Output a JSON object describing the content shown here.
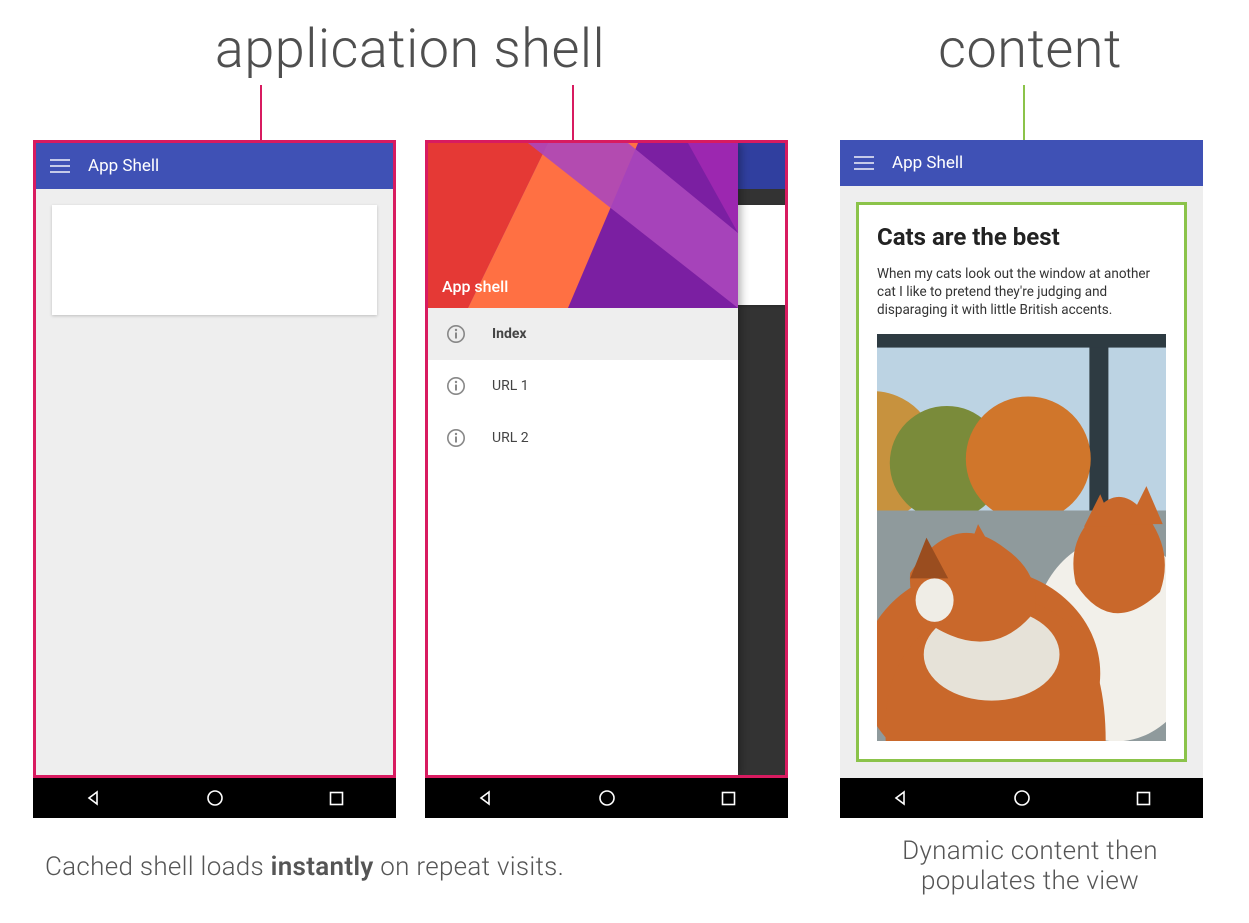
{
  "headings": {
    "app_shell": "application shell",
    "content": "content"
  },
  "appbar": {
    "title": "App Shell"
  },
  "drawer": {
    "header_label": "App shell",
    "items": [
      {
        "label": "Index",
        "active": true
      },
      {
        "label": "URL 1",
        "active": false
      },
      {
        "label": "URL 2",
        "active": false
      }
    ]
  },
  "content": {
    "title": "Cats are the best",
    "body": "When my cats look out the window at another cat I like to pretend they're judging and disparaging it with little British accents."
  },
  "captions": {
    "left_pre": "Cached shell loads ",
    "left_strong": "instantly",
    "left_post": " on repeat visits.",
    "right_line1": "Dynamic content then",
    "right_line2": "populates the view"
  },
  "colors": {
    "pink": "#d81b60",
    "green": "#8bc34a",
    "appbar": "#3f51b5"
  }
}
